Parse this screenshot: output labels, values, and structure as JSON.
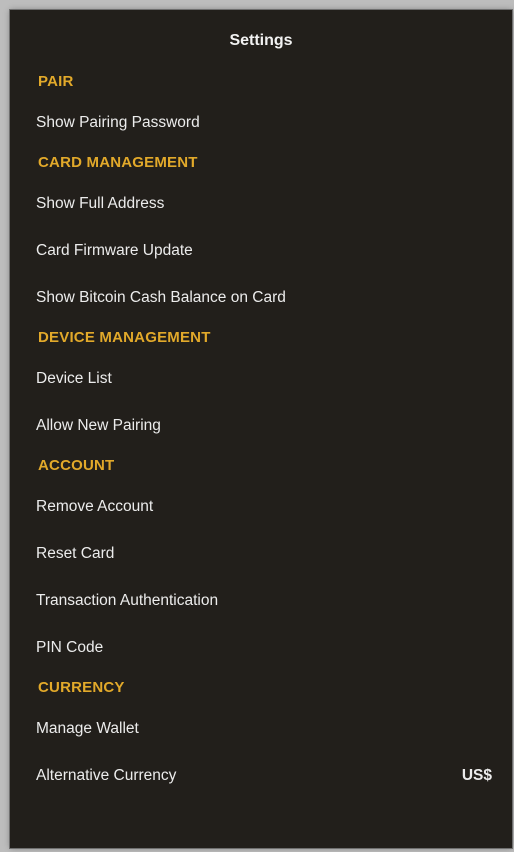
{
  "header": {
    "title": "Settings"
  },
  "colors": {
    "section": "#e2a92a",
    "background": "#221f1b",
    "text": "#ececec"
  },
  "sections": [
    {
      "heading": "PAIR",
      "items": [
        {
          "label": "Show Pairing Password"
        }
      ]
    },
    {
      "heading": "CARD MANAGEMENT",
      "items": [
        {
          "label": "Show Full Address"
        },
        {
          "label": "Card Firmware Update"
        },
        {
          "label": "Show Bitcoin Cash Balance on Card"
        }
      ]
    },
    {
      "heading": "DEVICE MANAGEMENT",
      "items": [
        {
          "label": "Device List"
        },
        {
          "label": "Allow New Pairing"
        }
      ]
    },
    {
      "heading": "ACCOUNT",
      "items": [
        {
          "label": "Remove Account"
        },
        {
          "label": "Reset Card"
        },
        {
          "label": "Transaction Authentication"
        },
        {
          "label": "PIN Code"
        }
      ]
    },
    {
      "heading": "CURRENCY",
      "items": [
        {
          "label": "Manage Wallet"
        },
        {
          "label": "Alternative Currency",
          "value": "US$"
        }
      ]
    }
  ]
}
